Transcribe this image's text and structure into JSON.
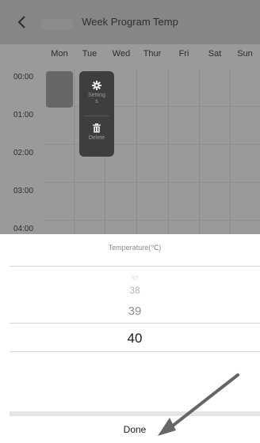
{
  "header": {
    "title": "Week Program Temp",
    "back_icon": "chevron-left-icon"
  },
  "days": [
    "Mon",
    "Tue",
    "Wed",
    "Thur",
    "Fri",
    "Sat",
    "Sun"
  ],
  "times": [
    "00:00",
    "01:00",
    "02:00",
    "03:00",
    "04:00"
  ],
  "context_menu": {
    "setting_label": "Setting\ns",
    "setting_icon": "gear-icon",
    "delete_label": "Delete",
    "delete_icon": "trash-icon"
  },
  "picker": {
    "title": "Temperature(℃)",
    "values_above": [
      "37",
      "38",
      "39"
    ],
    "selected": "40"
  },
  "done_label": "Done",
  "colors": {
    "overlay": "#9a9a9a",
    "navbar": "#868686",
    "popup": "#3e3e3e",
    "annotation_arrow": "#666666"
  }
}
